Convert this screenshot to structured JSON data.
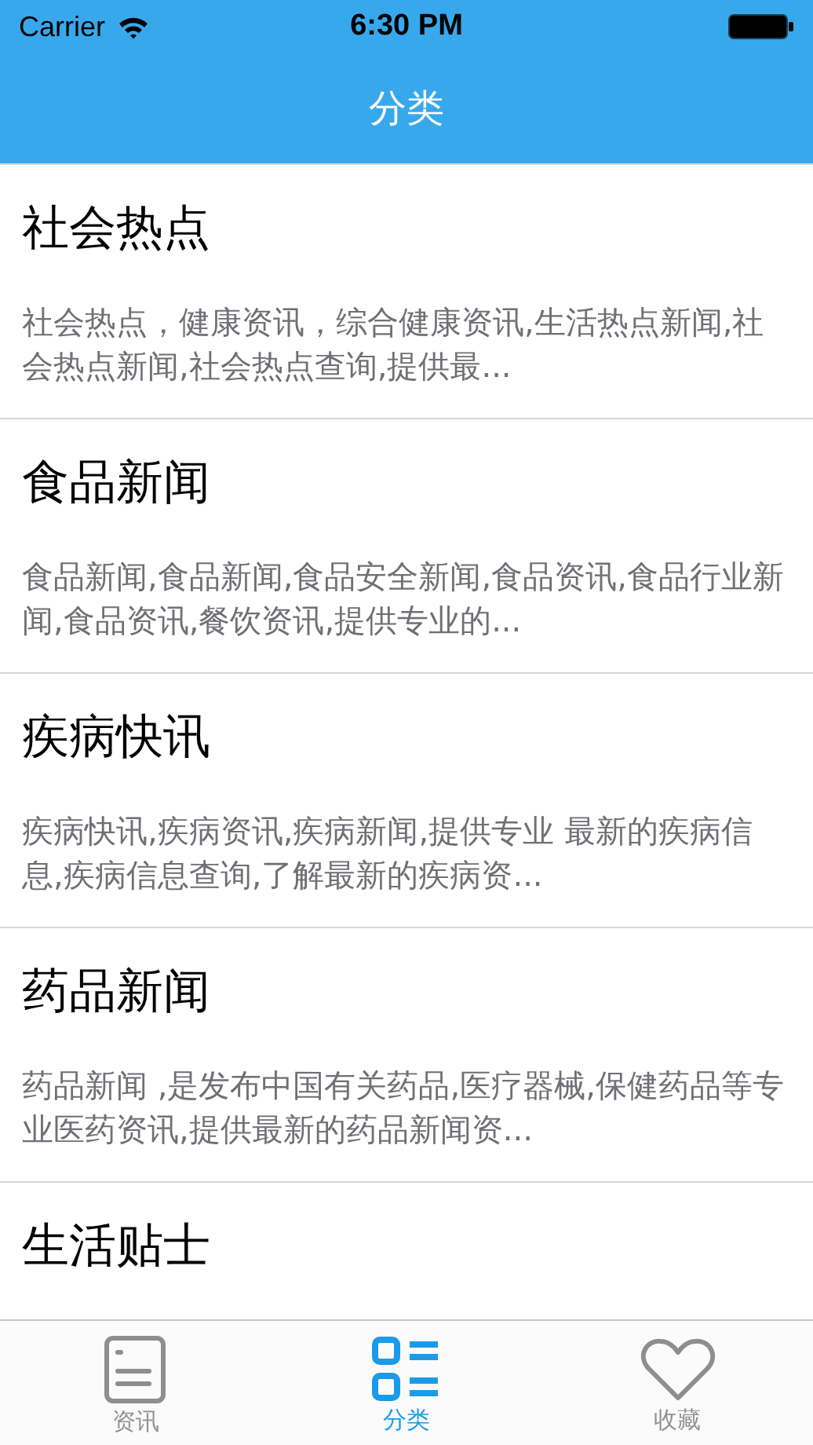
{
  "status_bar": {
    "carrier": "Carrier",
    "time": "6:30 PM"
  },
  "nav_bar": {
    "title": "分类"
  },
  "categories": [
    {
      "title": "社会热点",
      "description": "社会热点，健康资讯，综合健康资讯,生活热点新闻,社会热点新闻,社会热点查询,提供最..."
    },
    {
      "title": "食品新闻",
      "description": "食品新闻,食品新闻,食品安全新闻,食品资讯,食品行业新闻,食品资讯,餐饮资讯,提供专业的..."
    },
    {
      "title": "疾病快讯",
      "description": "疾病快讯,疾病资讯,疾病新闻,提供专业 最新的疾病信息,疾病信息查询,了解最新的疾病资..."
    },
    {
      "title": "药品新闻",
      "description": "药品新闻 ,是发布中国有关药品,医疗器械,保健药品等专业医药资讯,提供最新的药品新闻资..."
    },
    {
      "title": "生活贴士"
    }
  ],
  "tab_bar": [
    {
      "kind": "news",
      "label": "资讯",
      "selected": false
    },
    {
      "kind": "category",
      "label": "分类",
      "selected": true
    },
    {
      "kind": "favorite",
      "label": "收藏",
      "selected": false
    }
  ]
}
